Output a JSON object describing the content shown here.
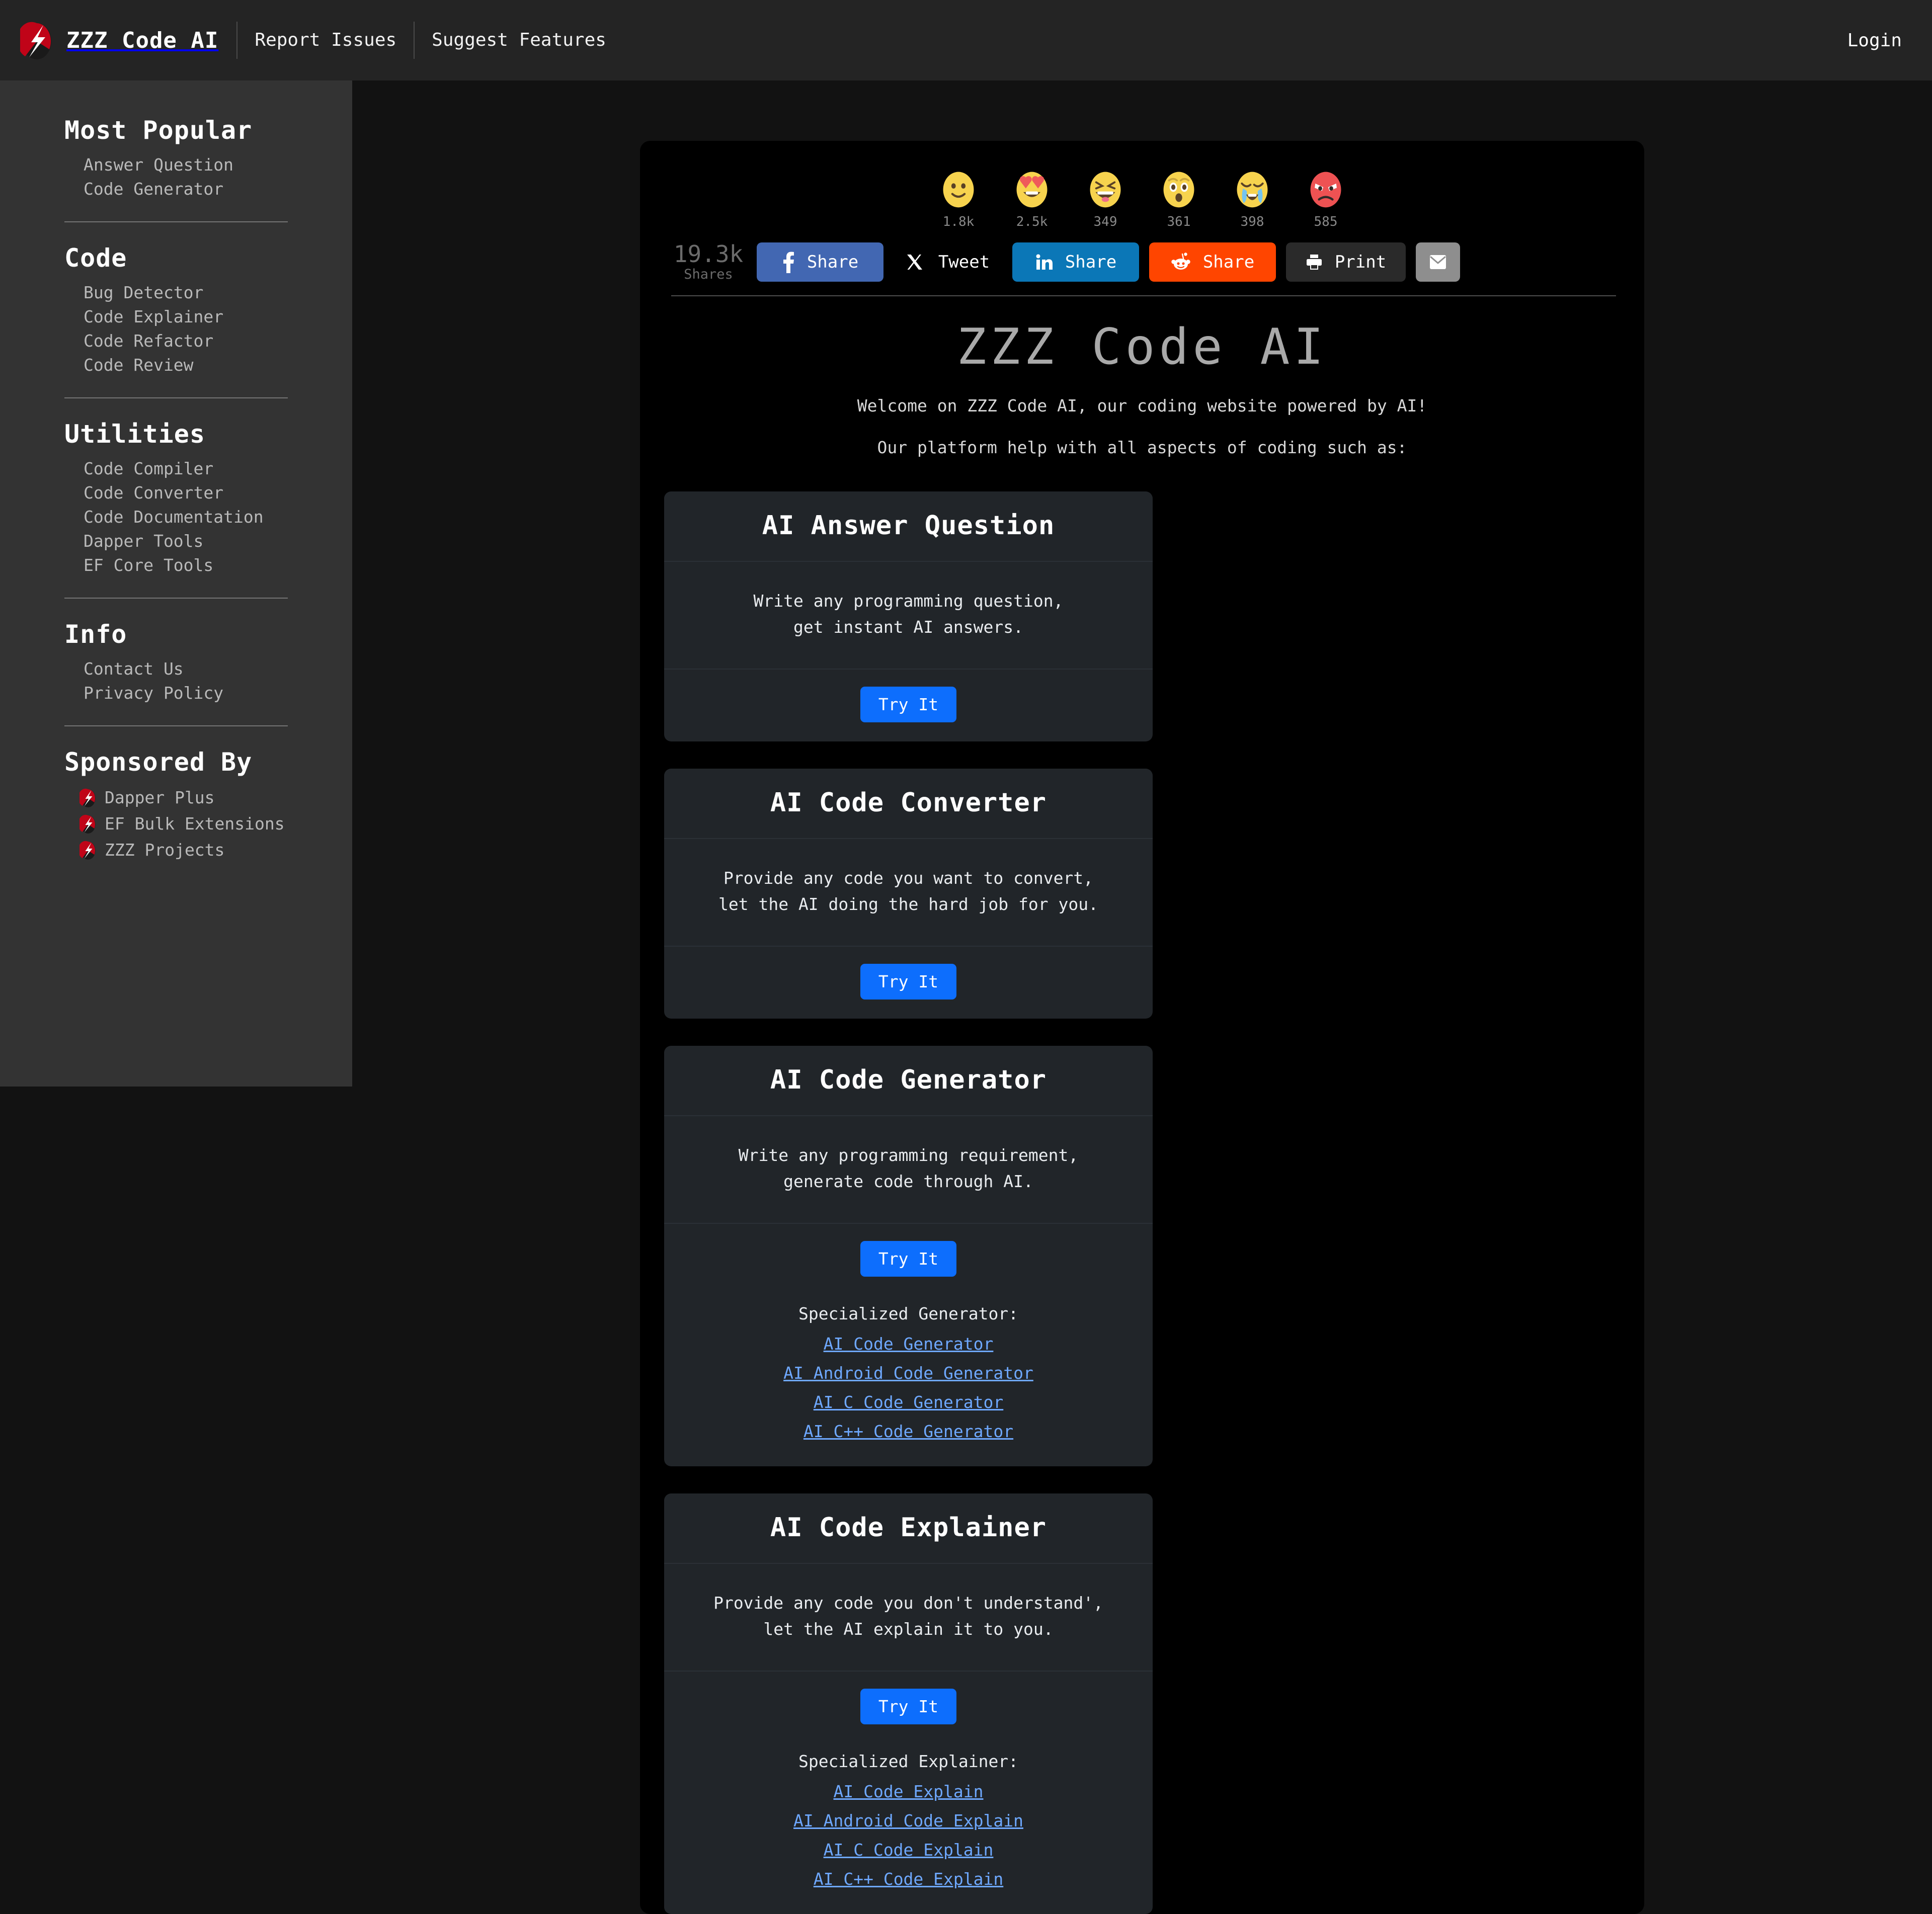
{
  "header": {
    "logo_icon": "zzz-lightning-logo",
    "brand": "ZZZ Code AI",
    "nav": [
      {
        "label": "Report Issues"
      },
      {
        "label": "Suggest Features"
      }
    ],
    "login": "Login"
  },
  "sidebar": {
    "groups": [
      {
        "title": "Most Popular",
        "items": [
          {
            "label": "Answer Question"
          },
          {
            "label": "Code Generator"
          }
        ]
      },
      {
        "title": "Code",
        "items": [
          {
            "label": "Bug Detector"
          },
          {
            "label": "Code Explainer"
          },
          {
            "label": "Code Refactor"
          },
          {
            "label": "Code Review"
          }
        ]
      },
      {
        "title": "Utilities",
        "items": [
          {
            "label": "Code Compiler"
          },
          {
            "label": "Code Converter"
          },
          {
            "label": "Code Documentation"
          },
          {
            "label": "Dapper Tools"
          },
          {
            "label": "EF Core Tools"
          }
        ]
      },
      {
        "title": "Info",
        "items": [
          {
            "label": "Contact Us"
          },
          {
            "label": "Privacy Policy"
          }
        ]
      }
    ],
    "sponsored": {
      "title": "Sponsored By",
      "items": [
        {
          "label": "Dapper Plus",
          "icon": "zzz-lightning-logo"
        },
        {
          "label": "EF Bulk Extensions",
          "icon": "zzz-lightning-logo"
        },
        {
          "label": "ZZZ Projects",
          "icon": "zzz-lightning-logo"
        }
      ]
    }
  },
  "reactions": [
    {
      "icon": "smile-emoji",
      "count": "1.8k"
    },
    {
      "icon": "heart-eyes-emoji",
      "count": "2.5k"
    },
    {
      "icon": "laughing-emoji",
      "count": "349"
    },
    {
      "icon": "surprised-emoji",
      "count": "361"
    },
    {
      "icon": "crying-emoji",
      "count": "398"
    },
    {
      "icon": "angry-emoji",
      "count": "585"
    }
  ],
  "share": {
    "count": "19.3k",
    "count_label": "Shares",
    "facebook_label": "Share",
    "twitter_label": "Tweet",
    "linkedin_label": "Share",
    "reddit_label": "Share",
    "print_label": "Print",
    "email_icon": "envelope-icon"
  },
  "hero": {
    "title": "ZZZ Code AI",
    "welcome": "Welcome on ZZZ Code AI, our coding website powered by AI!",
    "subtitle": "Our platform help with all aspects of coding such as:"
  },
  "cards": [
    {
      "title": "AI Answer Question",
      "line1": "Write any programming question,",
      "line2": "get instant AI answers.",
      "button": "Try It"
    },
    {
      "title": "AI Code Converter",
      "line1": "Provide any code you want to convert,",
      "line2": "let the AI doing the hard job for you.",
      "button": "Try It"
    },
    {
      "title": "AI Code Generator",
      "line1": "Write any programming requirement,",
      "line2": "generate code through AI.",
      "button": "Try It",
      "links_title": "Specialized Generator:",
      "links": [
        {
          "label": "AI Code Generator"
        },
        {
          "label": "AI Android Code Generator"
        },
        {
          "label": "AI C Code Generator"
        },
        {
          "label": "AI C++ Code Generator"
        }
      ]
    },
    {
      "title": "AI Code Explainer",
      "line1": "Provide any code you don't understand',",
      "line2": "let the AI explain it to you.",
      "button": "Try It",
      "links_title": "Specialized Explainer:",
      "links": [
        {
          "label": "AI Code Explain"
        },
        {
          "label": "AI Android Code Explain"
        },
        {
          "label": "AI C Code Explain"
        },
        {
          "label": "AI C++ Code Explain"
        }
      ]
    }
  ],
  "colors": {
    "accent_blue": "#0d6efd",
    "link_blue": "#6ea8fe",
    "facebook": "#4267b2",
    "linkedin": "#0b77b7",
    "reddit": "#ff4500",
    "sidebar_bg": "#333333",
    "panel_bg": "#000000",
    "card_bg": "#212529"
  }
}
